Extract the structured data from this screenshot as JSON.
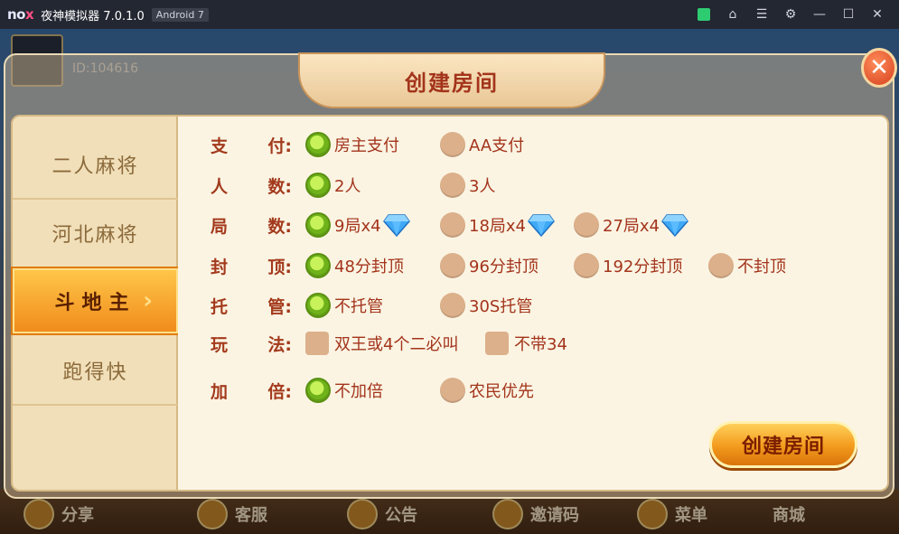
{
  "titlebar": {
    "logo_main": "no",
    "logo_x": "x",
    "title": "夜神模拟器 7.0.1.0",
    "android_badge": "Android 7",
    "icons": [
      "store-icon",
      "shirt-icon",
      "menu-icon",
      "settings-icon",
      "minimize-icon",
      "maximize-icon",
      "close-icon"
    ]
  },
  "background": {
    "user_id": "ID:104616",
    "bottom_buttons": [
      "分享",
      "客服",
      "公告",
      "邀请码",
      "菜单",
      "商城"
    ]
  },
  "dialog": {
    "title": "创建房间",
    "close_symbol": "✕",
    "sidebar": {
      "items": [
        "二人麻将",
        "河北麻将",
        "斗地主",
        "跑得快"
      ],
      "active_index": 2
    },
    "rows": [
      {
        "label_a": "支",
        "label_b": "付:",
        "options": [
          {
            "text": "房主支付",
            "type": "radio",
            "selected": true
          },
          {
            "text": "AA支付",
            "type": "radio",
            "selected": false
          }
        ]
      },
      {
        "label_a": "人",
        "label_b": "数:",
        "options": [
          {
            "text": "2人",
            "type": "radio",
            "selected": true
          },
          {
            "text": "3人",
            "type": "radio",
            "selected": false
          }
        ]
      },
      {
        "label_a": "局",
        "label_b": "数:",
        "options": [
          {
            "text": "9局x4",
            "type": "radio",
            "selected": true,
            "icon": "diamond-icon"
          },
          {
            "text": "18局x4",
            "type": "radio",
            "selected": false,
            "icon": "diamond-icon"
          },
          {
            "text": "27局x4",
            "type": "radio",
            "selected": false,
            "icon": "diamond-icon"
          }
        ]
      },
      {
        "label_a": "封",
        "label_b": "顶:",
        "options": [
          {
            "text": "48分封顶",
            "type": "radio",
            "selected": true
          },
          {
            "text": "96分封顶",
            "type": "radio",
            "selected": false
          },
          {
            "text": "192分封顶",
            "type": "radio",
            "selected": false
          },
          {
            "text": "不封顶",
            "type": "radio",
            "selected": false
          }
        ]
      },
      {
        "label_a": "托",
        "label_b": "管:",
        "options": [
          {
            "text": "不托管",
            "type": "radio",
            "selected": true
          },
          {
            "text": "30S托管",
            "type": "radio",
            "selected": false
          }
        ]
      },
      {
        "label_a": "玩",
        "label_b": "法:",
        "options": [
          {
            "text": "双王或4个二必叫",
            "type": "checkbox",
            "selected": false
          },
          {
            "text": "不带34",
            "type": "checkbox",
            "selected": false
          }
        ]
      },
      {
        "label_a": "加",
        "label_b": "倍:",
        "options": [
          {
            "text": "不加倍",
            "type": "radio",
            "selected": true
          },
          {
            "text": "农民优先",
            "type": "radio",
            "selected": false
          }
        ]
      }
    ],
    "create_button": "创建房间"
  },
  "colors": {
    "label": "#a33a1c",
    "selected_radio": "#6fb21a",
    "unselected_radio": "#dcb08a",
    "active_tab": "#f5a623"
  }
}
